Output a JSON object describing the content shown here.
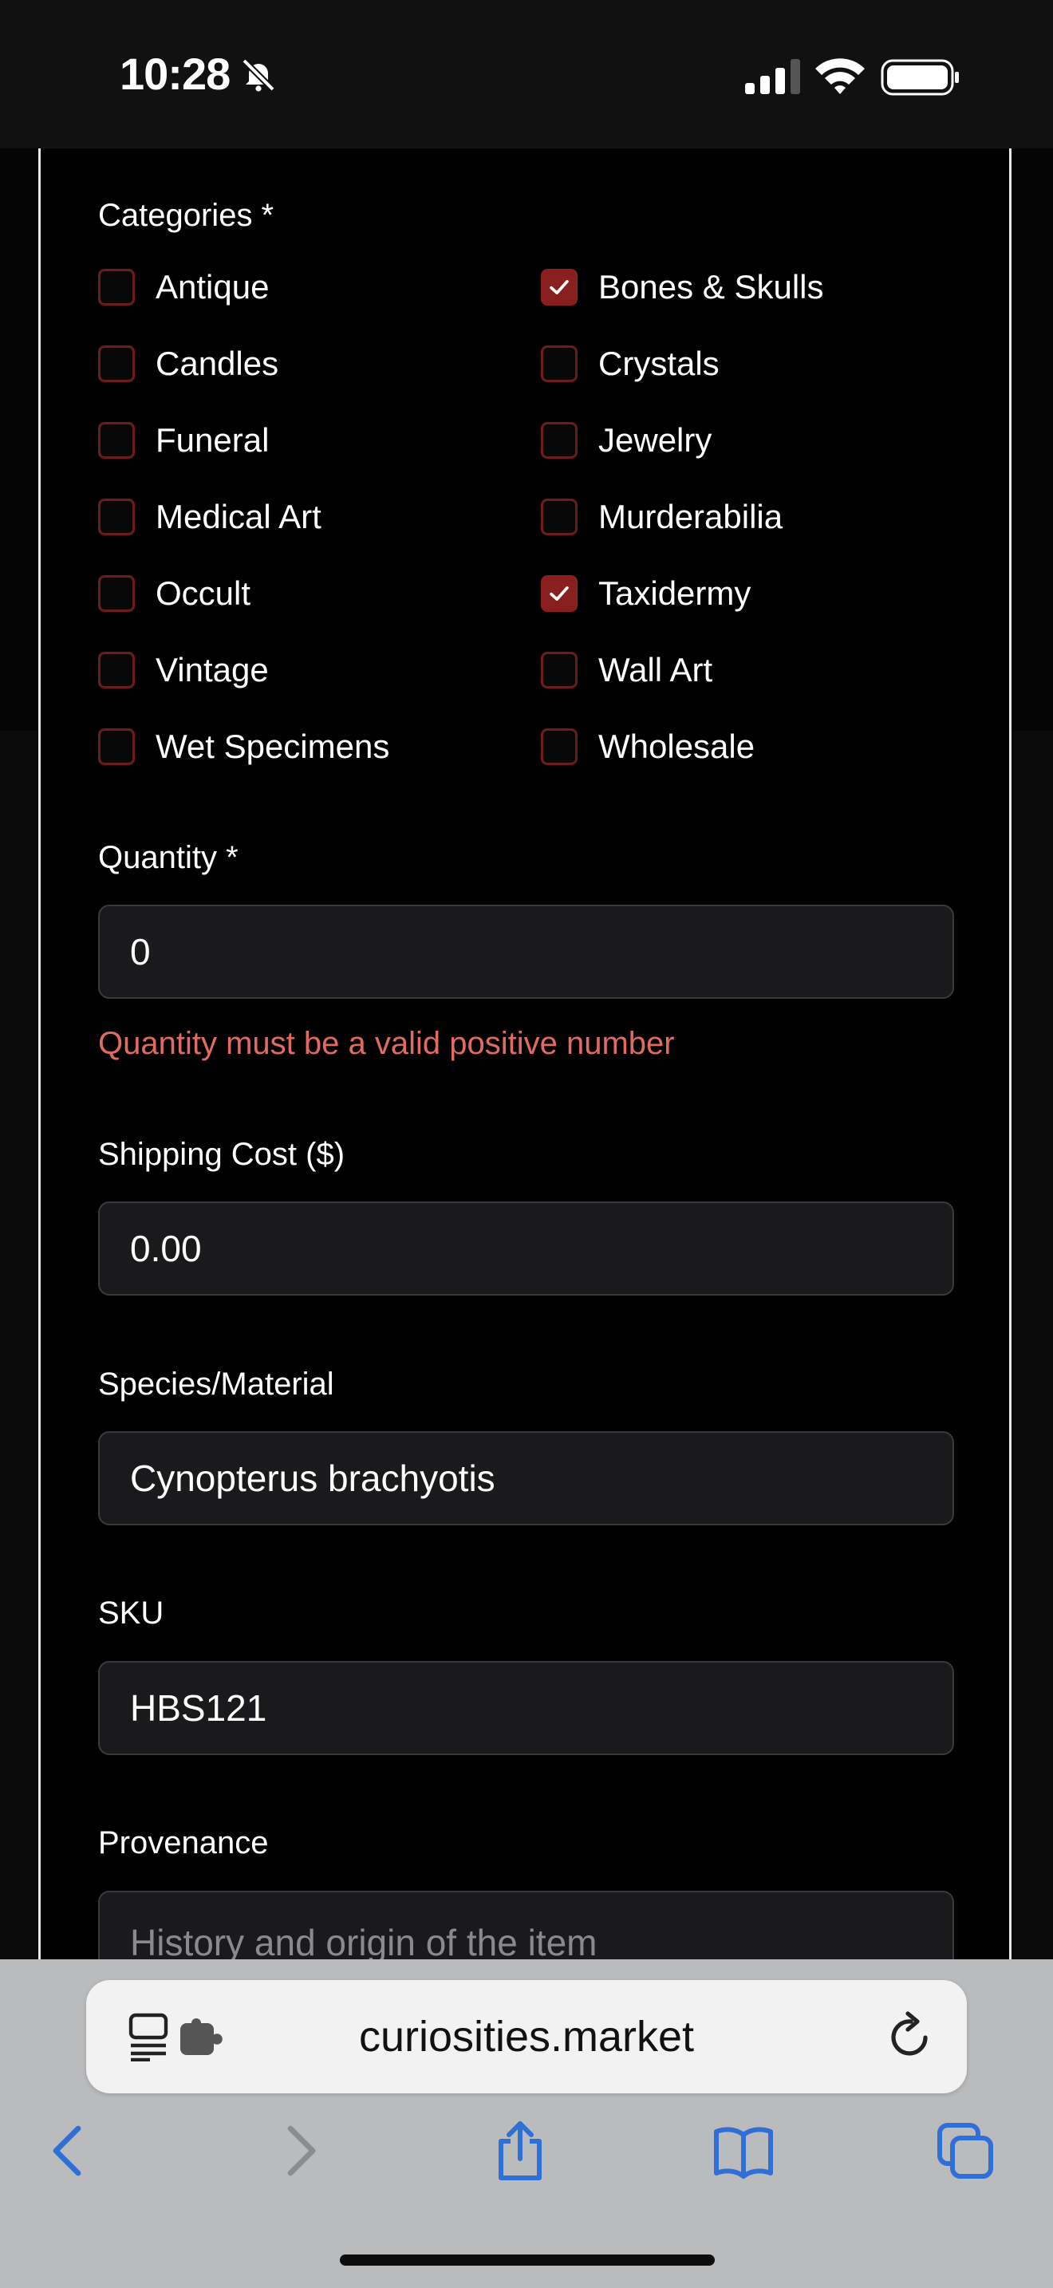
{
  "status_bar": {
    "time": "10:28"
  },
  "form": {
    "categories": {
      "label": "Categories *",
      "items": [
        {
          "label": "Antique",
          "checked": false
        },
        {
          "label": "Bones & Skulls",
          "checked": true
        },
        {
          "label": "Candles",
          "checked": false
        },
        {
          "label": "Crystals",
          "checked": false
        },
        {
          "label": "Funeral",
          "checked": false
        },
        {
          "label": "Jewelry",
          "checked": false
        },
        {
          "label": "Medical Art",
          "checked": false
        },
        {
          "label": "Murderabilia",
          "checked": false
        },
        {
          "label": "Occult",
          "checked": false
        },
        {
          "label": "Taxidermy",
          "checked": true
        },
        {
          "label": "Vintage",
          "checked": false
        },
        {
          "label": "Wall Art",
          "checked": false
        },
        {
          "label": "Wet Specimens",
          "checked": false
        },
        {
          "label": "Wholesale",
          "checked": false
        }
      ]
    },
    "quantity": {
      "label": "Quantity *",
      "value": "0",
      "error": "Quantity must be a valid positive number"
    },
    "shipping": {
      "label": "Shipping Cost ($)",
      "value": "0.00"
    },
    "species": {
      "label": "Species/Material",
      "value": "Cynopterus brachyotis"
    },
    "sku": {
      "label": "SKU",
      "value": "HBS121"
    },
    "provenance": {
      "label": "Provenance",
      "placeholder": "History and origin of the item"
    }
  },
  "browser": {
    "url": "curiosities.market"
  },
  "colors": {
    "accent": "#8a1f1f",
    "error": "#e06b63",
    "browser_blue": "#2f6fd6"
  }
}
